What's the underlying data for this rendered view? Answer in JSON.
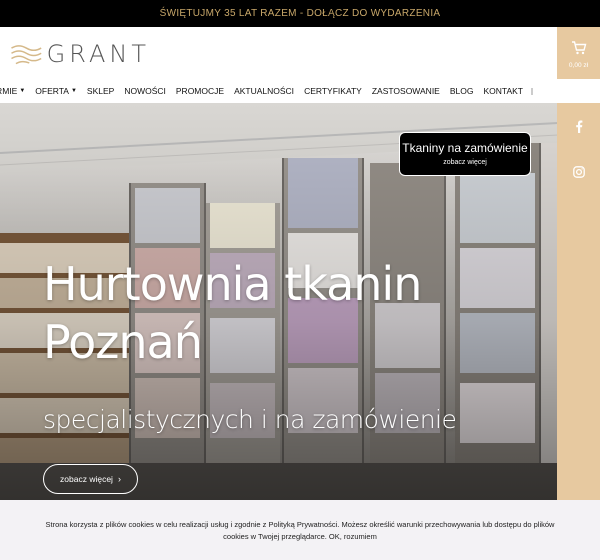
{
  "announcement": {
    "text": "ŚWIĘTUJMY 35 LAT RAZEM - DOŁĄCZ DO WYDARZENIA"
  },
  "logo": {
    "text": "GRANT"
  },
  "nav": {
    "items": [
      {
        "label": "O FIRMIE",
        "dropdown": true
      },
      {
        "label": "OFERTA",
        "dropdown": true
      },
      {
        "label": "SKLEP",
        "dropdown": false
      },
      {
        "label": "NOWOŚCI",
        "dropdown": false
      },
      {
        "label": "PROMOCJE",
        "dropdown": false
      },
      {
        "label": "AKTUALNOŚCI",
        "dropdown": false
      },
      {
        "label": "CERTYFIKATY",
        "dropdown": false
      },
      {
        "label": "ZASTOSOWANIE",
        "dropdown": false
      },
      {
        "label": "BLOG",
        "dropdown": false
      },
      {
        "label": "KONTAKT",
        "dropdown": false
      }
    ]
  },
  "cart": {
    "amount": "0,00 zł"
  },
  "promo": {
    "title": "Tkaniny na zamówienie",
    "link": "zobacz więcej"
  },
  "hero": {
    "title_line1": "Hurtownia tkanin",
    "title_line2": "Poznań",
    "subtitle": "specjalistycznych i na zamówienie",
    "button": "zobacz więcej",
    "button_arrow": "›"
  },
  "social": [
    {
      "icon": "facebook-icon",
      "glyph": "f"
    },
    {
      "icon": "instagram-icon",
      "glyph": ""
    }
  ],
  "cookie": {
    "text": "Strona korzysta z plików cookies w celu realizacji usług i zgodnie z Polityką Prywatności. Możesz określić warunki przechowywania lub dostępu do plików cookies w Twojej przeglądarce. OK, rozumiem"
  },
  "colors": {
    "accent": "#e7c9a0",
    "gold_text": "#c9a86a",
    "topbar": "#000000",
    "cookie_bg": "#f3f2f5"
  }
}
